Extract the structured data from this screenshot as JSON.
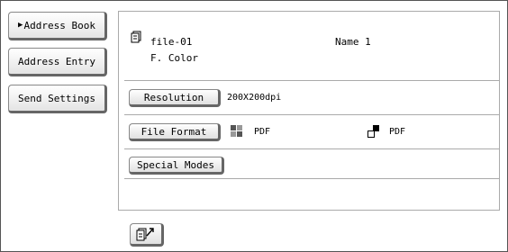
{
  "sidebar": {
    "address_book": "Address Book",
    "address_book_arrow": "▶",
    "address_entry": "Address Entry",
    "send_settings": "Send Settings"
  },
  "file": {
    "name": "file-01",
    "color": "F. Color",
    "destination": "Name 1"
  },
  "settings": {
    "resolution_label": "Resolution",
    "resolution_value": "200X200dpi",
    "file_format_label": "File Format",
    "format_color": "PDF",
    "format_bw": "PDF",
    "special_modes_label": "Special Modes"
  },
  "colors": {
    "border": "#888888",
    "accent": "#000000"
  },
  "icons": {
    "file": "file-stack-icon",
    "color_format": "color-quad-icon",
    "bw_format": "black-white-icon",
    "preview": "preview-scan-icon"
  }
}
